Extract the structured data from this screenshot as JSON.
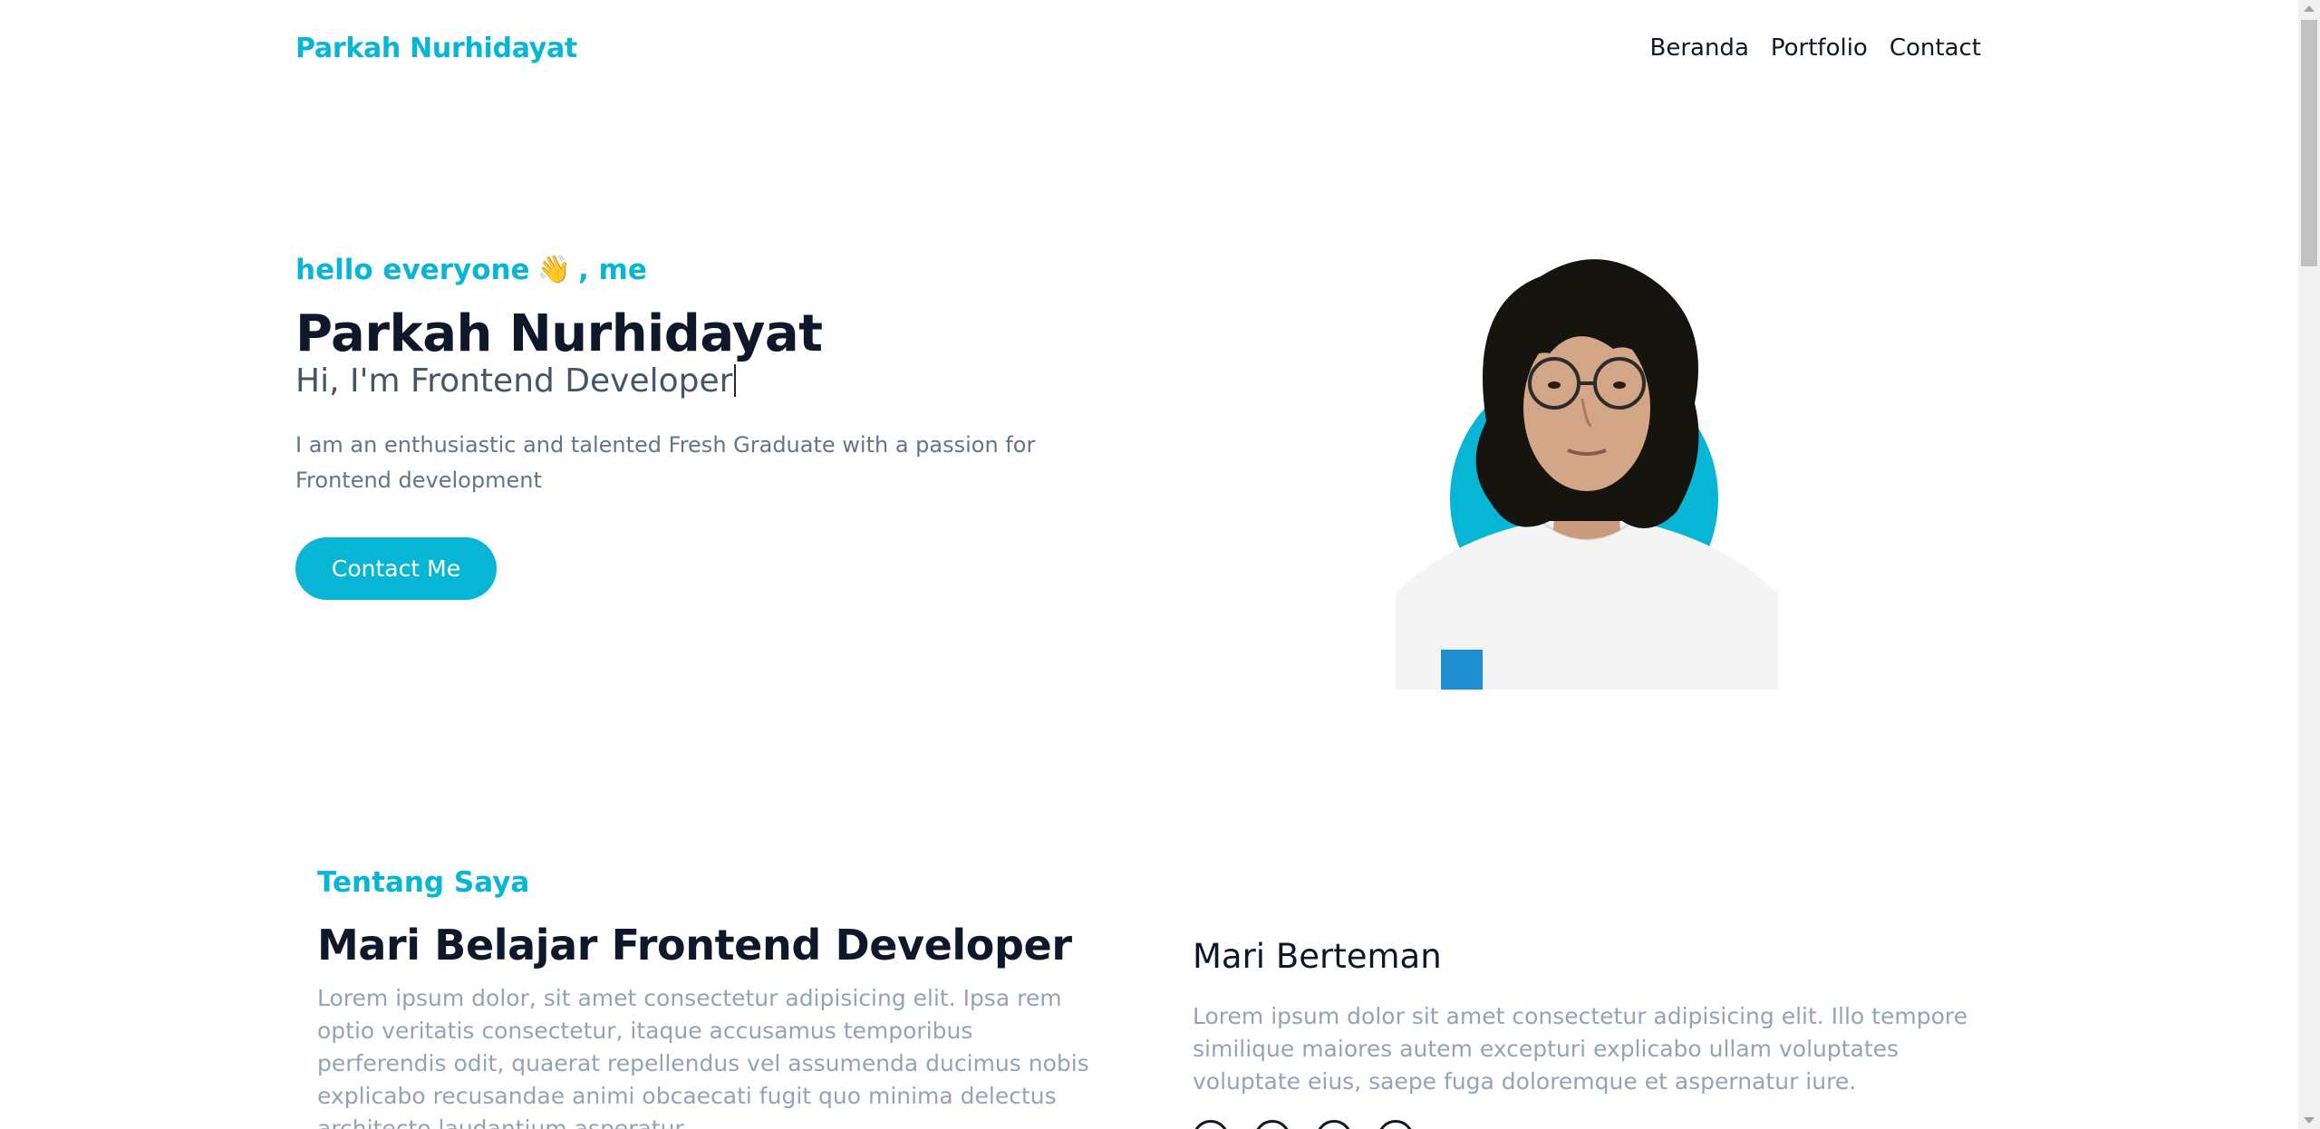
{
  "header": {
    "brand": "Parkah Nurhidayat",
    "nav": [
      "Beranda",
      "Portfolio",
      "Contact"
    ]
  },
  "hero": {
    "greeting_before": "hello everyone",
    "greeting_emoji": "👋",
    "greeting_after": ", me",
    "name": "Parkah Nurhidayat",
    "role": "Hi, I'm Frontend Developer",
    "description": "I am an enthusiastic and talented Fresh Graduate with a passion for Frontend development",
    "cta_label": "Contact Me"
  },
  "about": {
    "kicker": "Tentang Saya",
    "title": "Mari Belajar Frontend Developer",
    "body": "Lorem ipsum dolor, sit amet consectetur adipisicing elit. Ipsa rem optio veritatis consectetur, itaque accusamus temporibus perferendis odit, quaerat repellendus vel assumenda ducimus nobis explicabo recusandae animi obcaecati fugit quo minima delectus architecto laudantium asperatur"
  },
  "friends": {
    "title": "Mari Berteman",
    "body": "Lorem ipsum dolor sit amet consectetur adipisicing elit. Illo tempore similique maiores autem excepturi explicabo ullam voluptates voluptate eius, saepe fuga doloremque et aspernatur iure.",
    "social_icons": [
      "github-icon",
      "instagram-icon",
      "youtube-icon",
      "facebook-icon"
    ]
  },
  "colors": {
    "accent": "#06b6d4",
    "heading": "#0f172a",
    "muted": "#94a3b8"
  }
}
